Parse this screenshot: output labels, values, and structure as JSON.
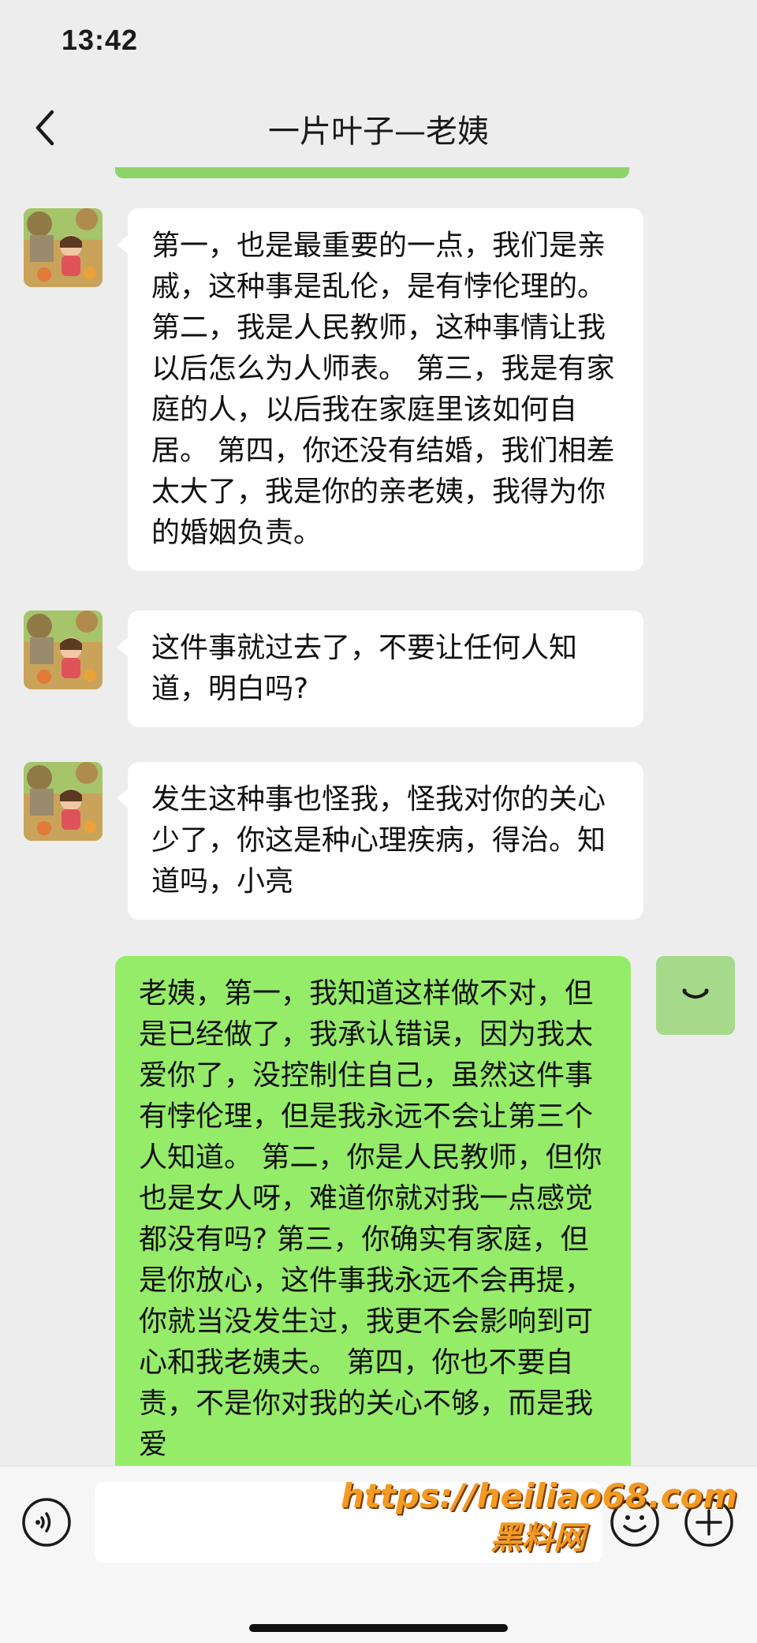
{
  "status_bar": {
    "time": "13:42"
  },
  "header": {
    "title": "一片叶子—老姨"
  },
  "messages": [
    {
      "side": "incoming",
      "text": "第一，也是最重要的一点，我们是亲戚，这种事是乱伦，是有悖伦理的。 第二，我是人民教师，这种事情让我以后怎么为人师表。 第三，我是有家庭的人，以后我在家庭里该如何自居。 第四，你还没有结婚，我们相差太大了，我是你的亲老姨，我得为你的婚姻负责。"
    },
    {
      "side": "incoming",
      "text": "这件事就过去了，不要让任何人知道，明白吗?"
    },
    {
      "side": "incoming",
      "text": "发生这种事也怪我，怪我对你的关心少了，你这是种心理疾病，得治。知道吗，小亮"
    },
    {
      "side": "outgoing",
      "text": "老姨，第一，我知道这样做不对，但是已经做了，我承认错误，因为我太爱你了，没控制住自己，虽然这件事有悖伦理，但是我永远不会让第三个人知道。 第二，你是人民教师，但你也是女人呀，难道你就对我一点感觉都没有吗? 第三，你确实有家庭，但是你放心，这件事我永远不会再提，你就当没发生过，我更不会影响到可心和我老姨夫。 第四，你也不要自责，不是你对我的关心不够，而是我爱"
    }
  ],
  "self_avatar": {
    "glyph": "◡"
  },
  "watermark": {
    "url": "https://heiliao68.com",
    "name": "黑料网"
  },
  "colors": {
    "background": "#ededed",
    "incoming_bubble": "#ffffff",
    "outgoing_bubble": "#95ec69",
    "watermark": "#f39a22"
  },
  "icons": [
    "back-chevron-icon",
    "voice-icon",
    "emoji-icon",
    "plus-icon"
  ]
}
